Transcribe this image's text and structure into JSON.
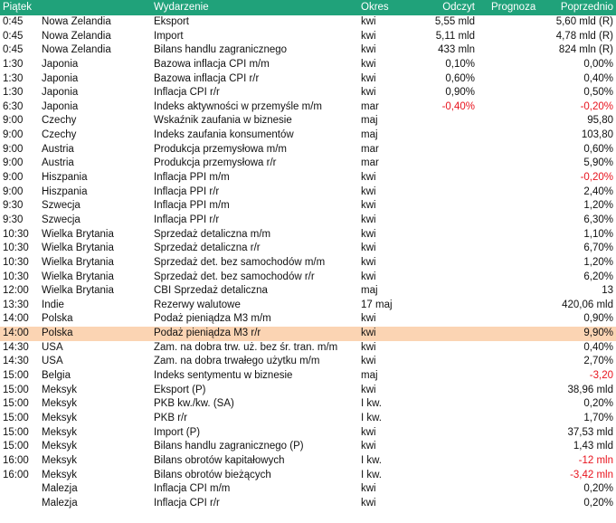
{
  "colors": {
    "header_bg": "#20a27a",
    "highlight": "#fbd4b3",
    "negative": "#e8141e"
  },
  "header": {
    "time": "Piątek",
    "event": "Wydarzenie",
    "period": "Okres",
    "actual": "Odczyt",
    "forecast": "Prognoza",
    "previous": "Poprzednio"
  },
  "rows": [
    {
      "time": "0:45",
      "country": "Nowa Zelandia",
      "event": "Eksport",
      "period": "kwi",
      "actual": "5,55 mld",
      "forecast": "",
      "previous": "5,60 mld (R)"
    },
    {
      "time": "0:45",
      "country": "Nowa Zelandia",
      "event": "Import",
      "period": "kwi",
      "actual": "5,11 mld",
      "forecast": "",
      "previous": "4,78 mld (R)"
    },
    {
      "time": "0:45",
      "country": "Nowa Zelandia",
      "event": "Bilans handlu zagranicznego",
      "period": "kwi",
      "actual": "433 mln",
      "forecast": "",
      "previous": "824 mln (R)"
    },
    {
      "time": "1:30",
      "country": "Japonia",
      "event": "Bazowa inflacja CPI m/m",
      "period": "kwi",
      "actual": "0,10%",
      "forecast": "",
      "previous": "0,00%"
    },
    {
      "time": "1:30",
      "country": "Japonia",
      "event": "Bazowa inflacja CPI r/r",
      "period": "kwi",
      "actual": "0,60%",
      "forecast": "",
      "previous": "0,40%"
    },
    {
      "time": "1:30",
      "country": "Japonia",
      "event": "Inflacja CPI r/r",
      "period": "kwi",
      "actual": "0,90%",
      "forecast": "",
      "previous": "0,50%"
    },
    {
      "time": "6:30",
      "country": "Japonia",
      "event": "Indeks aktywności w przemyśle m/m",
      "period": "mar",
      "actual": "-0,40%",
      "forecast": "",
      "previous": "-0,20%",
      "actual_neg": true,
      "previous_neg": true
    },
    {
      "time": "9:00",
      "country": "Czechy",
      "event": "Wskaźnik zaufania w biznesie",
      "period": "maj",
      "actual": "",
      "forecast": "",
      "previous": "95,80"
    },
    {
      "time": "9:00",
      "country": "Czechy",
      "event": "Indeks zaufania konsumentów",
      "period": "maj",
      "actual": "",
      "forecast": "",
      "previous": "103,80"
    },
    {
      "time": "9:00",
      "country": "Austria",
      "event": "Produkcja przemysłowa m/m",
      "period": "mar",
      "actual": "",
      "forecast": "",
      "previous": "0,60%"
    },
    {
      "time": "9:00",
      "country": "Austria",
      "event": "Produkcja przemysłowa r/r",
      "period": "mar",
      "actual": "",
      "forecast": "",
      "previous": "5,90%"
    },
    {
      "time": "9:00",
      "country": "Hiszpania",
      "event": "Inflacja PPI m/m",
      "period": "kwi",
      "actual": "",
      "forecast": "",
      "previous": "-0,20%",
      "previous_neg": true
    },
    {
      "time": "9:00",
      "country": "Hiszpania",
      "event": "Inflacja PPI r/r",
      "period": "kwi",
      "actual": "",
      "forecast": "",
      "previous": "2,40%"
    },
    {
      "time": "9:30",
      "country": "Szwecja",
      "event": "Inflacja PPI m/m",
      "period": "kwi",
      "actual": "",
      "forecast": "",
      "previous": "1,20%"
    },
    {
      "time": "9:30",
      "country": "Szwecja",
      "event": "Inflacja PPI r/r",
      "period": "kwi",
      "actual": "",
      "forecast": "",
      "previous": "6,30%"
    },
    {
      "time": "10:30",
      "country": "Wielka Brytania",
      "event": "Sprzedaż detaliczna m/m",
      "period": "kwi",
      "actual": "",
      "forecast": "",
      "previous": "1,10%"
    },
    {
      "time": "10:30",
      "country": "Wielka Brytania",
      "event": "Sprzedaż detaliczna r/r",
      "period": "kwi",
      "actual": "",
      "forecast": "",
      "previous": "6,70%"
    },
    {
      "time": "10:30",
      "country": "Wielka Brytania",
      "event": "Sprzedaż det. bez samochodów m/m",
      "period": "kwi",
      "actual": "",
      "forecast": "",
      "previous": "1,20%"
    },
    {
      "time": "10:30",
      "country": "Wielka Brytania",
      "event": "Sprzedaż det. bez samochodów r/r",
      "period": "kwi",
      "actual": "",
      "forecast": "",
      "previous": "6,20%"
    },
    {
      "time": "12:00",
      "country": "Wielka Brytania",
      "event": "CBI Sprzedaż detaliczna",
      "period": "maj",
      "actual": "",
      "forecast": "",
      "previous": "13"
    },
    {
      "time": "13:30",
      "country": "Indie",
      "event": "Rezerwy walutowe",
      "period": "17 maj",
      "actual": "",
      "forecast": "",
      "previous": "420,06 mld"
    },
    {
      "time": "14:00",
      "country": "Polska",
      "event": "Podaż pieniądza M3 m/m",
      "period": "kwi",
      "actual": "",
      "forecast": "",
      "previous": "0,90%"
    },
    {
      "time": "14:00",
      "country": "Polska",
      "event": "Podaż pieniądza M3 r/r",
      "period": "kwi",
      "actual": "",
      "forecast": "",
      "previous": "9,90%",
      "highlight": true
    },
    {
      "time": "14:30",
      "country": "USA",
      "event": "Zam. na dobra trw. uż. bez śr. tran. m/m",
      "period": "kwi",
      "actual": "",
      "forecast": "",
      "previous": "0,40%"
    },
    {
      "time": "14:30",
      "country": "USA",
      "event": "Zam. na dobra trwałego użytku m/m",
      "period": "kwi",
      "actual": "",
      "forecast": "",
      "previous": "2,70%"
    },
    {
      "time": "15:00",
      "country": "Belgia",
      "event": "Indeks sentymentu w biznesie",
      "period": "maj",
      "actual": "",
      "forecast": "",
      "previous": "-3,20",
      "previous_neg": true
    },
    {
      "time": "15:00",
      "country": "Meksyk",
      "event": "Eksport (P)",
      "period": "kwi",
      "actual": "",
      "forecast": "",
      "previous": "38,96 mld"
    },
    {
      "time": "15:00",
      "country": "Meksyk",
      "event": "PKB kw./kw. (SA)",
      "period": "I kw.",
      "actual": "",
      "forecast": "",
      "previous": "0,20%"
    },
    {
      "time": "15:00",
      "country": "Meksyk",
      "event": "PKB r/r",
      "period": "I kw.",
      "actual": "",
      "forecast": "",
      "previous": "1,70%"
    },
    {
      "time": "15:00",
      "country": "Meksyk",
      "event": "Import (P)",
      "period": "kwi",
      "actual": "",
      "forecast": "",
      "previous": "37,53 mld"
    },
    {
      "time": "15:00",
      "country": "Meksyk",
      "event": "Bilans handlu zagranicznego (P)",
      "period": "kwi",
      "actual": "",
      "forecast": "",
      "previous": "1,43 mld"
    },
    {
      "time": "16:00",
      "country": "Meksyk",
      "event": "Bilans obrotów kapitałowych",
      "period": "I kw.",
      "actual": "",
      "forecast": "",
      "previous": "-12 mln",
      "previous_neg": true
    },
    {
      "time": "16:00",
      "country": "Meksyk",
      "event": "Bilans obrotów bieżących",
      "period": "I kw.",
      "actual": "",
      "forecast": "",
      "previous": "-3,42 mln",
      "previous_neg": true
    },
    {
      "time": "",
      "country": "Malezja",
      "event": "Inflacja CPI m/m",
      "period": "kwi",
      "actual": "",
      "forecast": "",
      "previous": "0,20%"
    },
    {
      "time": "",
      "country": "Malezja",
      "event": "Inflacja CPI r/r",
      "period": "kwi",
      "actual": "",
      "forecast": "",
      "previous": "0,20%"
    }
  ]
}
